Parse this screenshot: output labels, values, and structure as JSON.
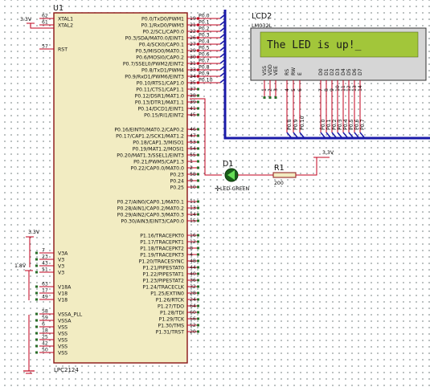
{
  "chip": {
    "ref": "U1",
    "part": "LPC2124",
    "left_pins": [
      {
        "num": "62",
        "name": "XTAL1"
      },
      {
        "num": "61",
        "name": "XTAL2"
      },
      {
        "num": "57",
        "name": "RST"
      },
      {
        "num": "7",
        "name": "V3A"
      },
      {
        "num": "23",
        "name": "V3"
      },
      {
        "num": "43",
        "name": "V3"
      },
      {
        "num": "51",
        "name": "V3"
      },
      {
        "num": "63",
        "name": "V18A"
      },
      {
        "num": "17",
        "name": "V18"
      },
      {
        "num": "49",
        "name": "V18"
      },
      {
        "num": "58",
        "name": "VSSA_PLL"
      },
      {
        "num": "59",
        "name": "VSSA"
      },
      {
        "num": "6",
        "name": "VSS"
      },
      {
        "num": "18",
        "name": "VSS"
      },
      {
        "num": "25",
        "name": "VSS"
      },
      {
        "num": "42",
        "name": "VSS"
      },
      {
        "num": "50",
        "name": "VSS"
      }
    ],
    "right_pins": [
      {
        "num": "19",
        "name": "P0.0/TxD0/PWM1"
      },
      {
        "num": "21",
        "name": "P0.1/RxD0/PWM3"
      },
      {
        "num": "22",
        "name": "P0.2/SCL/CAP0.0"
      },
      {
        "num": "26",
        "name": "P0.3/SDA/MAT0.0/EINT1"
      },
      {
        "num": "27",
        "name": "P0.4/SCK0/CAP0.1"
      },
      {
        "num": "29",
        "name": "P0.5/MISO0/MAT0.1"
      },
      {
        "num": "30",
        "name": "P0.6/MOSI0/CAP0.2"
      },
      {
        "num": "31",
        "name": "P0.7/SSEL0/PWM2/EINT2"
      },
      {
        "num": "33",
        "name": "P0.8/TxD1/PWM4"
      },
      {
        "num": "34",
        "name": "P0.9/RxD1/PWM6/EINT3"
      },
      {
        "num": "35",
        "name": "P0.10/RTS1/CAP1.0"
      },
      {
        "num": "37",
        "name": "P0.11/CTS1/CAP1.1"
      },
      {
        "num": "38",
        "name": "P0.12/DSR1/MAT1.0"
      },
      {
        "num": "39",
        "name": "P0.13/DTR1/MAT1.1"
      },
      {
        "num": "41",
        "name": "P0.14/DCD1/EINT1"
      },
      {
        "num": "45",
        "name": "P0.15/RI1/EINT2"
      },
      {
        "num": "46",
        "name": "P0.16/EINT0/MAT0.2/CAP0.2"
      },
      {
        "num": "47",
        "name": "P0.17/CAP1.2/SCK1/MAT1.2"
      },
      {
        "num": "53",
        "name": "P0.18/CAP1.3/MISO1"
      },
      {
        "num": "54",
        "name": "P0.19/MAT1.2/MOSI1"
      },
      {
        "num": "55",
        "name": "P0.20/MAT1.3/SSEL1/EINT3"
      },
      {
        "num": "1",
        "name": "P0.21/PWM5/CAP1.3"
      },
      {
        "num": "2",
        "name": "P0.22/CAP0.0/MAT0.0"
      },
      {
        "num": "58",
        "name": "P0.23"
      },
      {
        "num": "9",
        "name": "P0.24"
      },
      {
        "num": "10",
        "name": "P0.25"
      },
      {
        "num": "11",
        "name": "P0.27/AIN0/CAP0.1/MAT0.1"
      },
      {
        "num": "13",
        "name": "P0.28/AIN1/CAP0.2/MAT0.2"
      },
      {
        "num": "14",
        "name": "P0.29/AIN2/CAP0.3/MAT0.3"
      },
      {
        "num": "15",
        "name": "P0.30/AIN3/EINT3/CAP0.0"
      },
      {
        "num": "16",
        "name": "P1.16/TRACEPKT0"
      },
      {
        "num": "12",
        "name": "P1.17/TRACEPKT1"
      },
      {
        "num": "8",
        "name": "P1.18/TRACEPKT2"
      },
      {
        "num": "4",
        "name": "P1.19/TRACEPKT3"
      },
      {
        "num": "48",
        "name": "P1.20/TRACESYNC"
      },
      {
        "num": "44",
        "name": "P1.21/PIPESTAT0"
      },
      {
        "num": "40",
        "name": "P1.22/PIPESTAT1"
      },
      {
        "num": "36",
        "name": "P1.23/PIPESTAT2"
      },
      {
        "num": "32",
        "name": "P1.24/TRACECLK"
      },
      {
        "num": "28",
        "name": "P1.25/EXTIN0"
      },
      {
        "num": "24",
        "name": "P1.26/RTCK"
      },
      {
        "num": "64",
        "name": "P1.27/TDO"
      },
      {
        "num": "60",
        "name": "P1.28/TDI"
      },
      {
        "num": "56",
        "name": "P1.29/TCK"
      },
      {
        "num": "52",
        "name": "P1.30/TMS"
      },
      {
        "num": "20",
        "name": "P1.31/TRST"
      }
    ]
  },
  "nets": [
    "P0.0",
    "P0.1",
    "P0.2",
    "P0.3",
    "P0.4",
    "P0.5",
    "P0.6",
    "P0.7",
    "P0.8",
    "P0.9",
    "P0.10"
  ],
  "power": {
    "v33_top": "3.3V",
    "v33_mid": "3.3V",
    "v18": "1.8V",
    "v33_res": "3.3V"
  },
  "lcd": {
    "ref": "LCD2",
    "part": "LM032L",
    "text": "The LED is up!_",
    "pin_labels": [
      "VSS",
      "VDD",
      "VEE",
      "RS",
      "RW",
      "E",
      "D0",
      "D1",
      "D2",
      "D3",
      "D4",
      "D5",
      "D6",
      "D7"
    ],
    "pin_nums": [
      "1",
      "2",
      "3",
      "4",
      "5",
      "6",
      "7",
      "8",
      "9",
      "10",
      "11",
      "12",
      "13",
      "14"
    ],
    "net_labels": [
      "P0.8",
      "P0.9",
      "P0.10",
      "P0.0",
      "P0.1",
      "P0.2",
      "P0.3",
      "P0.4",
      "P0.5",
      "P0.6",
      "P0.7"
    ]
  },
  "led": {
    "ref": "D1",
    "part": "LED-GREEN"
  },
  "resistor": {
    "ref": "R1",
    "value": "200"
  },
  "colors": {
    "wire": "#c0001c",
    "bus": "#1a1aa8",
    "chip_fill": "#f2ecc2",
    "chip_border": "#8a1414",
    "lcd_screen": "#a2c63a"
  }
}
